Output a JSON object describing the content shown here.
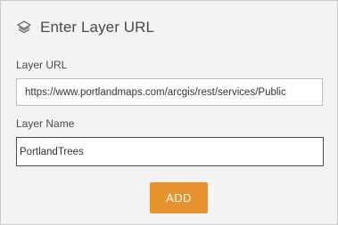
{
  "header": {
    "title": "Enter Layer URL",
    "icon": "layers-icon"
  },
  "form": {
    "url_label": "Layer URL",
    "url_value": "https://www.portlandmaps.com/arcgis/rest/services/Public",
    "name_label": "Layer Name",
    "name_value": "PortlandTrees",
    "add_label": "ADD"
  },
  "colors": {
    "accent": "#e8922d",
    "panel_bg": "#f3f3f3",
    "text": "#4a4a4a"
  }
}
